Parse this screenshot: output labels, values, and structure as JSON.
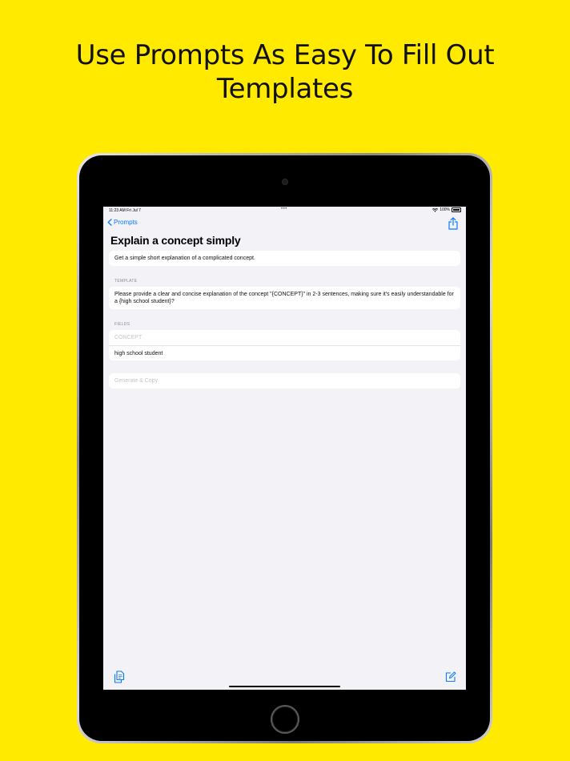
{
  "headline": {
    "line1": "Use Prompts As Easy To Fill Out",
    "line2": "Templates"
  },
  "status_bar": {
    "time": "11:23 AM   Fri Jul 7",
    "dots": "•••",
    "battery": "100%"
  },
  "nav": {
    "back_label": "Prompts",
    "back_icon": "chevron-left-icon",
    "share_icon": "share-icon"
  },
  "prompt": {
    "title": "Explain a concept simply",
    "description": "Get a simple short explanation of a complicated concept.",
    "template_label": "TEMPLATE",
    "template_text": "Please provide a clear and concise explanation of the concept \"{CONCEPT}\" in 2-3 sentences, making sure it's easily understandable for a {high school student}?",
    "fields_label": "FIELDS",
    "fields": [
      {
        "placeholder": "CONCEPT",
        "value": ""
      },
      {
        "placeholder": "",
        "value": "high school student"
      }
    ],
    "generate_label": "Generate & Copy"
  },
  "toolbar": {
    "left_icon": "copy-documents-icon",
    "right_icon": "compose-icon"
  },
  "colors": {
    "background": "#ffea00",
    "accent": "#0a7aff",
    "screen_bg": "#f2f2f7"
  }
}
